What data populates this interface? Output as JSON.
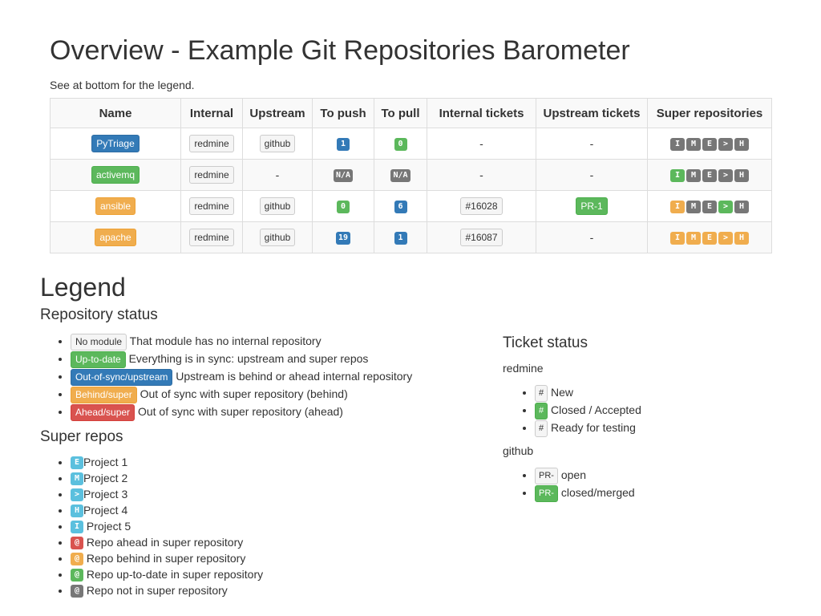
{
  "title": "Overview - Example Git Repositories Barometer",
  "subtitle": "See at bottom for the legend.",
  "columns": [
    "Name",
    "Internal",
    "Upstream",
    "To push",
    "To pull",
    "Internal tickets",
    "Upstream tickets",
    "Super repositories"
  ],
  "rows": [
    {
      "name": "PyTriage",
      "name_status": "primary",
      "internal": "redmine",
      "upstream": "github",
      "to_push": "1",
      "to_push_status": "primary",
      "to_pull": "0",
      "to_pull_status": "success",
      "internal_tickets": "-",
      "upstream_tickets": "-",
      "super": [
        {
          "t": "I",
          "s": "dark"
        },
        {
          "t": "M",
          "s": "dark"
        },
        {
          "t": "E",
          "s": "dark"
        },
        {
          "t": ">",
          "s": "dark"
        },
        {
          "t": "H",
          "s": "dark"
        }
      ]
    },
    {
      "name": "activemq",
      "name_status": "success",
      "internal": "redmine",
      "upstream": "-",
      "to_push": "N/A",
      "to_push_status": "dark",
      "to_pull": "N/A",
      "to_pull_status": "dark",
      "internal_tickets": "-",
      "upstream_tickets": "-",
      "super": [
        {
          "t": "I",
          "s": "success"
        },
        {
          "t": "M",
          "s": "dark"
        },
        {
          "t": "E",
          "s": "dark"
        },
        {
          "t": ">",
          "s": "dark"
        },
        {
          "t": "H",
          "s": "dark"
        }
      ]
    },
    {
      "name": "ansible",
      "name_status": "warning",
      "internal": "redmine",
      "upstream": "github",
      "to_push": "0",
      "to_push_status": "success",
      "to_pull": "6",
      "to_pull_status": "primary",
      "internal_tickets": "#16028",
      "internal_tickets_status": "default",
      "upstream_tickets": "PR-1",
      "upstream_tickets_status": "success",
      "super": [
        {
          "t": "I",
          "s": "warning"
        },
        {
          "t": "M",
          "s": "dark"
        },
        {
          "t": "E",
          "s": "dark"
        },
        {
          "t": ">",
          "s": "success"
        },
        {
          "t": "H",
          "s": "dark"
        }
      ]
    },
    {
      "name": "apache",
      "name_status": "warning",
      "internal": "redmine",
      "upstream": "github",
      "to_push": "19",
      "to_push_status": "primary",
      "to_pull": "1",
      "to_pull_status": "primary",
      "internal_tickets": "#16087",
      "internal_tickets_status": "default",
      "upstream_tickets": "-",
      "super": [
        {
          "t": "I",
          "s": "warning"
        },
        {
          "t": "M",
          "s": "warning"
        },
        {
          "t": "E",
          "s": "warning"
        },
        {
          "t": ">",
          "s": "warning"
        },
        {
          "t": "H",
          "s": "warning"
        }
      ]
    }
  ],
  "legend": {
    "title": "Legend",
    "repo_status": {
      "title": "Repository status",
      "items": [
        {
          "label": "No module",
          "status": "default",
          "text": "That module has no internal repository"
        },
        {
          "label": "Up-to-date",
          "status": "success",
          "text": "Everything is in sync: upstream and super repos"
        },
        {
          "label": "Out-of-sync/upstream",
          "status": "primary",
          "text": "Upstream is behind or ahead internal repository"
        },
        {
          "label": "Behind/super",
          "status": "warning",
          "text": "Out of sync with super repository (behind)"
        },
        {
          "label": "Ahead/super",
          "status": "danger",
          "text": "Out of sync with super repository (ahead)"
        }
      ]
    },
    "super_repos": {
      "title": "Super repos",
      "items": [
        {
          "label": "E",
          "status": "info",
          "text": "Project 1"
        },
        {
          "label": "M",
          "status": "info",
          "text": "Project 2"
        },
        {
          "label": ">",
          "status": "info",
          "text": "Project 3"
        },
        {
          "label": "H",
          "status": "info",
          "text": "Project 4"
        },
        {
          "label": "I",
          "status": "info",
          "text": " Project 5"
        },
        {
          "label": "@",
          "status": "danger",
          "text": " Repo ahead in super repository"
        },
        {
          "label": "@",
          "status": "warning",
          "text": " Repo behind in super repository"
        },
        {
          "label": "@",
          "status": "success",
          "text": " Repo up-to-date in super repository"
        },
        {
          "label": "@",
          "status": "dark",
          "text": " Repo not in super repository"
        }
      ]
    }
  },
  "ticket_status": {
    "title": "Ticket status",
    "groups": [
      {
        "name": "redmine",
        "items": [
          {
            "label": "#",
            "status": "default",
            "text": "New"
          },
          {
            "label": "#",
            "status": "success",
            "text": "Closed / Accepted"
          },
          {
            "label": "#",
            "status": "default",
            "text": "Ready for testing"
          }
        ]
      },
      {
        "name": "github",
        "items": [
          {
            "label": "PR-",
            "status": "default",
            "text": "open"
          },
          {
            "label": "PR-",
            "status": "success",
            "text": "closed/merged"
          }
        ]
      }
    ]
  },
  "colors": {
    "primary": "#337ab7",
    "success": "#5cb85c",
    "warning": "#f0ad4e",
    "danger": "#d9534f",
    "info": "#5bc0de",
    "dark": "#777777",
    "default": "#f5f5f5"
  }
}
